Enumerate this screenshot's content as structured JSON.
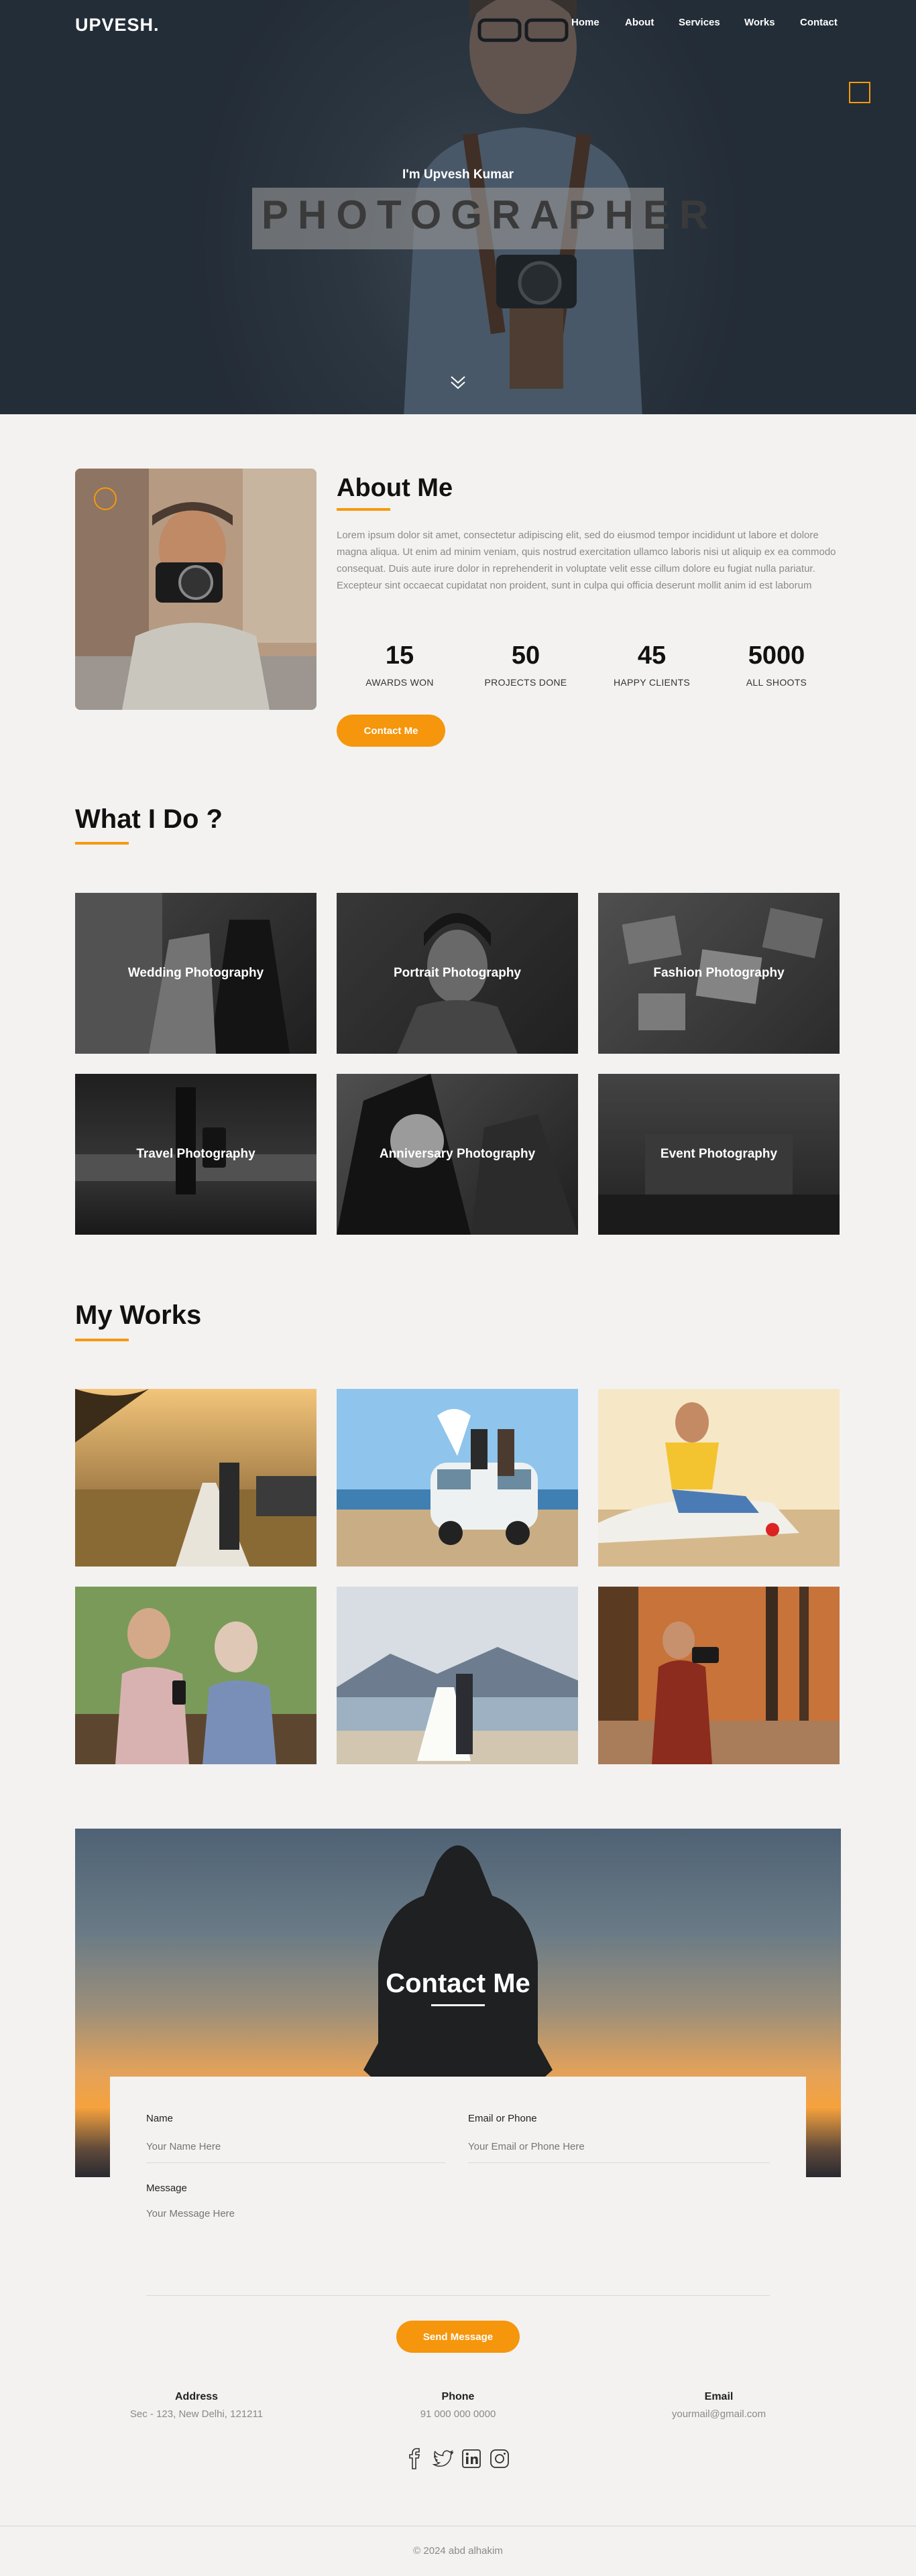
{
  "brand": {
    "logo": "UPVESH.",
    "accent": "#f5960c"
  },
  "nav": {
    "items": [
      "Home",
      "About",
      "Services",
      "Works",
      "Contact"
    ]
  },
  "hero": {
    "subtitle": "I'm Upvesh Kumar",
    "title": "PHOTOGRAPHER"
  },
  "about": {
    "title": "About Me",
    "text": "Lorem ipsum dolor sit amet, consectetur adipiscing elit, sed do eiusmod tempor incididunt ut labore et dolore magna aliqua. Ut enim ad minim veniam, quis nostrud exercitation ullamco laboris nisi ut aliquip ex ea commodo consequat. Duis aute irure dolor in reprehenderit in voluptate velit esse cillum dolore eu fugiat nulla pariatur. Excepteur sint occaecat cupidatat non proident, sunt in culpa qui officia deserunt mollit anim id est laborum",
    "stats": [
      {
        "value": "15",
        "label": "AWARDS WON"
      },
      {
        "value": "50",
        "label": "PROJECTS DONE"
      },
      {
        "value": "45",
        "label": "HAPPY CLIENTS"
      },
      {
        "value": "5000",
        "label": "ALL SHOOTS"
      }
    ],
    "button": "Contact Me"
  },
  "services": {
    "title": "What I Do ?",
    "items": [
      "Wedding Photography",
      "Portrait Photography",
      "Fashion Photography",
      "Travel Photography",
      "Anniversary Photography",
      "Event Photography"
    ]
  },
  "works": {
    "title": "My Works"
  },
  "contact": {
    "title": "Contact Me",
    "name_label": "Name",
    "name_placeholder": "Your Name Here",
    "email_label": "Email or Phone",
    "email_placeholder": "Your Email or Phone Here",
    "message_label": "Message",
    "message_placeholder": "Your Message Here",
    "send": "Send Message",
    "info": [
      {
        "heading": "Address",
        "value": "Sec - 123, New Delhi, 121211"
      },
      {
        "heading": "Phone",
        "value": "91 000 000 0000"
      },
      {
        "heading": "Email",
        "value": "yourmail@gmail.com"
      }
    ]
  },
  "footer": {
    "copyright": "© 2024 abd alhakim"
  }
}
